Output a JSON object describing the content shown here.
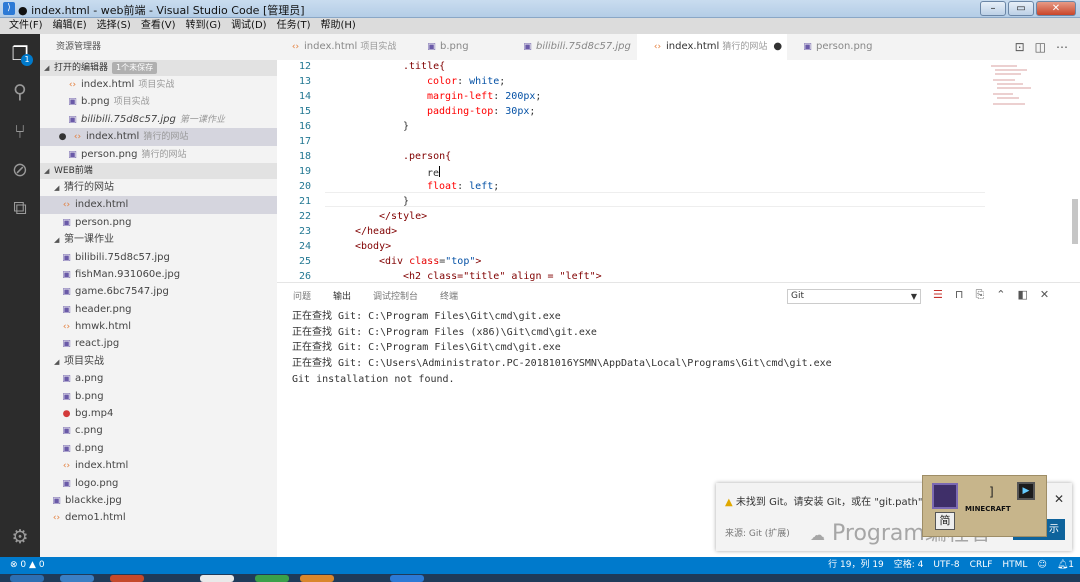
{
  "window": {
    "title": "● index.html - web前端 - Visual Studio Code [管理员]",
    "buttons": {
      "minimize": "–",
      "maximize": "▭",
      "close": "✕"
    }
  },
  "menu": [
    "文件(F)",
    "编辑(E)",
    "选择(S)",
    "查看(V)",
    "转到(G)",
    "调试(D)",
    "任务(T)",
    "帮助(H)"
  ],
  "activity_bar": {
    "explorer_badge": "1",
    "icons": [
      "files-icon",
      "search-icon",
      "source-control-icon",
      "debug-icon",
      "extensions-icon",
      "gear-icon"
    ]
  },
  "sidebar": {
    "title": "资源管理器",
    "open_editors": {
      "label": "打开的编辑器",
      "badge": "1个未保存",
      "items": [
        {
          "name": "index.html",
          "desc": "项目实战",
          "type": "html"
        },
        {
          "name": "b.png",
          "desc": "项目实战",
          "type": "img"
        },
        {
          "name": "bilibili.75d8c57.jpg",
          "desc": "第一课作业",
          "type": "img"
        },
        {
          "name": "index.html",
          "desc": "猜行的网站",
          "type": "html",
          "dirty": "●"
        },
        {
          "name": "person.png",
          "desc": "猜行的网站",
          "type": "img"
        }
      ]
    },
    "workspace": {
      "label": "WEB前端",
      "folder1": {
        "name": "猜行的网站",
        "items": [
          "index.html",
          "person.png"
        ]
      },
      "folder2": {
        "name": "第一课作业",
        "items": [
          "bilibili.75d8c57.jpg",
          "fishMan.931060e.jpg",
          "game.6bc7547.jpg",
          "header.png",
          "hmwk.html",
          "react.jpg"
        ]
      },
      "folder3": {
        "name": "项目实战",
        "items": [
          "a.png",
          "b.png",
          "bg.mp4",
          "c.png",
          "d.png",
          "index.html",
          "logo.png"
        ]
      },
      "root_items": [
        "blackke.jpg",
        "demo1.html"
      ]
    }
  },
  "tabs": [
    {
      "name": "index.html",
      "desc": "项目实战"
    },
    {
      "name": "b.png",
      "desc": ""
    },
    {
      "name": "bilibili.75d8c57.jpg",
      "desc": ""
    },
    {
      "name": "index.html",
      "desc": "猜行的网站",
      "dirty": "●"
    },
    {
      "name": "person.png",
      "desc": ""
    }
  ],
  "editor": {
    "line_numbers": [
      "12",
      "13",
      "14",
      "15",
      "16",
      "17",
      "18",
      "19",
      "20",
      "21",
      "22",
      "23",
      "24",
      "25",
      "26"
    ],
    "lines": {
      "l12": ".title{",
      "l13_p": "color",
      "l13_v": "white",
      "l14_p": "margin-left",
      "l14_v": "200px",
      "l15_p": "padding-top",
      "l15_v": "30px",
      "l16": "}",
      "l18": ".person{",
      "l19": "re",
      "l20_p": "float",
      "l20_v": "left",
      "l21": "}",
      "l22": "</style>",
      "l23": "</head>",
      "l24": "<body>",
      "l25_tag": "<div",
      "l25_attr": "class",
      "l25_val": "\"top\"",
      "l25_end": ">",
      "l26": "<h2 class=\"title\" align = \"left\">"
    }
  },
  "panel": {
    "tabs": [
      "问题",
      "输出",
      "调试控制台",
      "终端"
    ],
    "channel": "Git",
    "output_lines": [
      "正在查找 Git: C:\\Program Files\\Git\\cmd\\git.exe",
      "正在查找 Git: C:\\Program Files (x86)\\Git\\cmd\\git.exe",
      "正在查找 Git: C:\\Program Files\\Git\\cmd\\git.exe",
      "正在查找 Git: C:\\Users\\Administrator.PC-20181016YSMN\\AppData\\Local\\Programs\\Git\\cmd\\git.exe",
      "Git installation not found."
    ]
  },
  "notification": {
    "message": "未找到 Git。请安装 Git，或在 \"git.path\"",
    "source": "来源: Git (扩展)",
    "button": "示"
  },
  "watermark": {
    "text": "Program编程者"
  },
  "sticker": {
    "game_text": "MINECRAFT",
    "char": "简"
  },
  "status": {
    "errors": "0",
    "warnings": "0",
    "position": "行 19，列 19",
    "spaces": "空格: 4",
    "encoding": "UTF-8",
    "eol": "CRLF",
    "language": "HTML",
    "bell_count": "1"
  }
}
